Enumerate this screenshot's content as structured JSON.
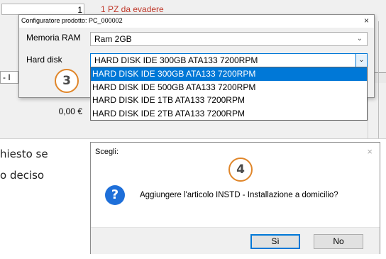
{
  "background": {
    "qty_value": "1",
    "pending_text": "1 PZ da evadere",
    "row_cell_text": "- I",
    "amount_text": "0,00 €"
  },
  "document_text": {
    "line1": "hiesto se",
    "line2": "o deciso"
  },
  "configurator": {
    "title": "Configuratore prodotto: PC_000002",
    "close_glyph": "×",
    "ram_label": "Memoria RAM",
    "ram_value": "Ram 2GB",
    "hdd_label": "Hard disk",
    "hdd_value": "HARD DISK IDE 300GB ATA133 7200RPM",
    "hdd_options": [
      "HARD DISK IDE 300GB ATA133 7200RPM",
      "HARD DISK IDE 500GB ATA133 7200RPM",
      "HARD DISK IDE 1TB ATA133 7200RPM",
      "HARD DISK IDE 2TB ATA133 7200RPM"
    ],
    "selected_option_index": 0
  },
  "badges": {
    "step3": "3",
    "step4": "4",
    "badge_border_color": "#e0862a"
  },
  "choose_dialog": {
    "title": "Scegli:",
    "close_glyph": "×",
    "icon": "question-icon",
    "message": "Aggiungere l'articolo INSTD - Installazione a domicilio?",
    "yes_label": "Sì",
    "no_label": "No"
  },
  "colors": {
    "selection_blue": "#0078d7",
    "pending_red": "#c0392b",
    "question_blue": "#1e6fd9"
  }
}
